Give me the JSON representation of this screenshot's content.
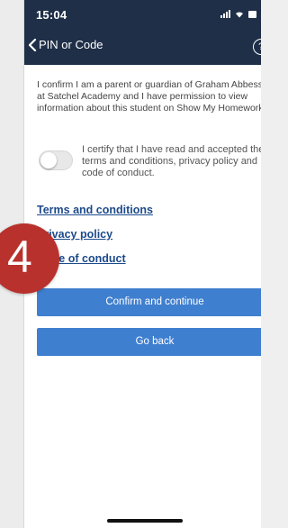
{
  "status_bar": {
    "time": "15:04",
    "icons": [
      "signal-icon",
      "wifi-icon",
      "battery-icon"
    ]
  },
  "nav": {
    "back_label": "PIN or Code",
    "help_symbol": "?"
  },
  "content": {
    "parent_confirmation": "I confirm I am a parent or guardian of Graham Abbess at Satchel Academy and I have permission to view information about this student on Show My Homework.",
    "terms_toggle_text": "I certify that I have read and accepted the terms and conditions, privacy policy and code of conduct.",
    "terms_toggle_on": false
  },
  "links": {
    "terms": "Terms and conditions",
    "privacy": "Privacy policy",
    "conduct": "Code of conduct"
  },
  "buttons": {
    "confirm": "Confirm and continue",
    "back": "Go back"
  },
  "annotation": {
    "step_number": "4"
  },
  "colors": {
    "nav_background": "#1f2f48",
    "button_background": "#3f7fcf",
    "link_color": "#1c4a8a",
    "step_badge": "#b8312c"
  }
}
